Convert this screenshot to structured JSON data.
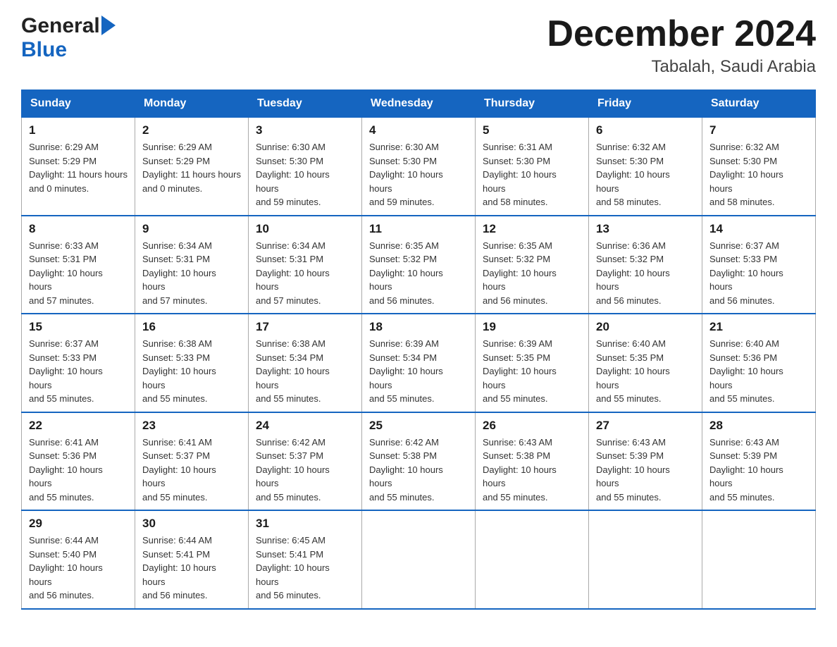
{
  "header": {
    "logo_general": "General",
    "logo_blue": "Blue",
    "title": "December 2024",
    "subtitle": "Tabalah, Saudi Arabia"
  },
  "days_of_week": [
    "Sunday",
    "Monday",
    "Tuesday",
    "Wednesday",
    "Thursday",
    "Friday",
    "Saturday"
  ],
  "weeks": [
    [
      {
        "day": "1",
        "sunrise": "6:29 AM",
        "sunset": "5:29 PM",
        "daylight": "11 hours and 0 minutes."
      },
      {
        "day": "2",
        "sunrise": "6:29 AM",
        "sunset": "5:29 PM",
        "daylight": "11 hours and 0 minutes."
      },
      {
        "day": "3",
        "sunrise": "6:30 AM",
        "sunset": "5:30 PM",
        "daylight": "10 hours and 59 minutes."
      },
      {
        "day": "4",
        "sunrise": "6:30 AM",
        "sunset": "5:30 PM",
        "daylight": "10 hours and 59 minutes."
      },
      {
        "day": "5",
        "sunrise": "6:31 AM",
        "sunset": "5:30 PM",
        "daylight": "10 hours and 58 minutes."
      },
      {
        "day": "6",
        "sunrise": "6:32 AM",
        "sunset": "5:30 PM",
        "daylight": "10 hours and 58 minutes."
      },
      {
        "day": "7",
        "sunrise": "6:32 AM",
        "sunset": "5:30 PM",
        "daylight": "10 hours and 58 minutes."
      }
    ],
    [
      {
        "day": "8",
        "sunrise": "6:33 AM",
        "sunset": "5:31 PM",
        "daylight": "10 hours and 57 minutes."
      },
      {
        "day": "9",
        "sunrise": "6:34 AM",
        "sunset": "5:31 PM",
        "daylight": "10 hours and 57 minutes."
      },
      {
        "day": "10",
        "sunrise": "6:34 AM",
        "sunset": "5:31 PM",
        "daylight": "10 hours and 57 minutes."
      },
      {
        "day": "11",
        "sunrise": "6:35 AM",
        "sunset": "5:32 PM",
        "daylight": "10 hours and 56 minutes."
      },
      {
        "day": "12",
        "sunrise": "6:35 AM",
        "sunset": "5:32 PM",
        "daylight": "10 hours and 56 minutes."
      },
      {
        "day": "13",
        "sunrise": "6:36 AM",
        "sunset": "5:32 PM",
        "daylight": "10 hours and 56 minutes."
      },
      {
        "day": "14",
        "sunrise": "6:37 AM",
        "sunset": "5:33 PM",
        "daylight": "10 hours and 56 minutes."
      }
    ],
    [
      {
        "day": "15",
        "sunrise": "6:37 AM",
        "sunset": "5:33 PM",
        "daylight": "10 hours and 55 minutes."
      },
      {
        "day": "16",
        "sunrise": "6:38 AM",
        "sunset": "5:33 PM",
        "daylight": "10 hours and 55 minutes."
      },
      {
        "day": "17",
        "sunrise": "6:38 AM",
        "sunset": "5:34 PM",
        "daylight": "10 hours and 55 minutes."
      },
      {
        "day": "18",
        "sunrise": "6:39 AM",
        "sunset": "5:34 PM",
        "daylight": "10 hours and 55 minutes."
      },
      {
        "day": "19",
        "sunrise": "6:39 AM",
        "sunset": "5:35 PM",
        "daylight": "10 hours and 55 minutes."
      },
      {
        "day": "20",
        "sunrise": "6:40 AM",
        "sunset": "5:35 PM",
        "daylight": "10 hours and 55 minutes."
      },
      {
        "day": "21",
        "sunrise": "6:40 AM",
        "sunset": "5:36 PM",
        "daylight": "10 hours and 55 minutes."
      }
    ],
    [
      {
        "day": "22",
        "sunrise": "6:41 AM",
        "sunset": "5:36 PM",
        "daylight": "10 hours and 55 minutes."
      },
      {
        "day": "23",
        "sunrise": "6:41 AM",
        "sunset": "5:37 PM",
        "daylight": "10 hours and 55 minutes."
      },
      {
        "day": "24",
        "sunrise": "6:42 AM",
        "sunset": "5:37 PM",
        "daylight": "10 hours and 55 minutes."
      },
      {
        "day": "25",
        "sunrise": "6:42 AM",
        "sunset": "5:38 PM",
        "daylight": "10 hours and 55 minutes."
      },
      {
        "day": "26",
        "sunrise": "6:43 AM",
        "sunset": "5:38 PM",
        "daylight": "10 hours and 55 minutes."
      },
      {
        "day": "27",
        "sunrise": "6:43 AM",
        "sunset": "5:39 PM",
        "daylight": "10 hours and 55 minutes."
      },
      {
        "day": "28",
        "sunrise": "6:43 AM",
        "sunset": "5:39 PM",
        "daylight": "10 hours and 55 minutes."
      }
    ],
    [
      {
        "day": "29",
        "sunrise": "6:44 AM",
        "sunset": "5:40 PM",
        "daylight": "10 hours and 56 minutes."
      },
      {
        "day": "30",
        "sunrise": "6:44 AM",
        "sunset": "5:41 PM",
        "daylight": "10 hours and 56 minutes."
      },
      {
        "day": "31",
        "sunrise": "6:45 AM",
        "sunset": "5:41 PM",
        "daylight": "10 hours and 56 minutes."
      },
      null,
      null,
      null,
      null
    ]
  ],
  "labels": {
    "sunrise": "Sunrise:",
    "sunset": "Sunset:",
    "daylight": "Daylight:"
  }
}
